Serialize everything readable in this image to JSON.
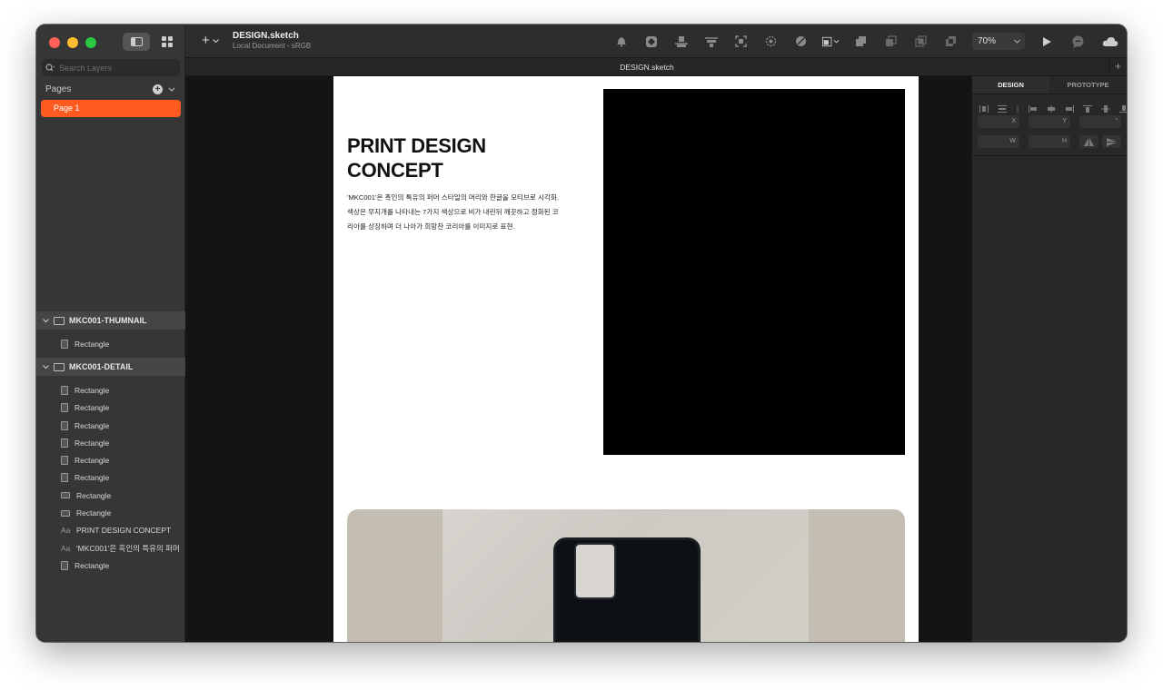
{
  "toolbar": {
    "doc_name": "DESIGN.sketch",
    "doc_sub": "Local Document - sRGB",
    "zoom_value": "70%",
    "tool_icons": [
      "bell-icon",
      "component-icon",
      "distribute-icon",
      "align-icon",
      "frame-icon",
      "mask-icon",
      "scissors-icon",
      "transform-icon",
      "union-icon",
      "subtract-icon",
      "intersect-icon",
      "difference-icon"
    ],
    "right_icons": [
      "play-icon",
      "comment-icon",
      "cloud-icon"
    ]
  },
  "sidebar": {
    "search_placeholder": "Search Layers",
    "pages_label": "Pages",
    "pages": [
      {
        "label": "Page 1",
        "selected": true
      }
    ],
    "groups": [
      {
        "name": "MKC001-THUMNAIL",
        "layers": [
          {
            "label": "Rectangle",
            "icon": "rect"
          }
        ]
      },
      {
        "name": "MKC001-DETAIL",
        "layers": [
          {
            "label": "Rectangle",
            "icon": "rect"
          },
          {
            "label": "Rectangle",
            "icon": "rect"
          },
          {
            "label": "Rectangle",
            "icon": "rect"
          },
          {
            "label": "Rectangle",
            "icon": "rect"
          },
          {
            "label": "Rectangle",
            "icon": "rect"
          },
          {
            "label": "Rectangle",
            "icon": "rect"
          },
          {
            "label": "Rectangle",
            "icon": "rect-wide"
          },
          {
            "label": "Rectangle",
            "icon": "rect-wide"
          },
          {
            "label": "PRINT DESIGN CONCEPT",
            "icon": "text"
          },
          {
            "label": "'MKC001'은 흑인의 특유의 퍼머",
            "icon": "text"
          },
          {
            "label": "Rectangle",
            "icon": "rect"
          }
        ]
      }
    ],
    "text_icon_glyph": "Aa"
  },
  "tabbar": {
    "title": "DESIGN.sketch"
  },
  "canvas": {
    "heading_line1": "PRINT DESIGN",
    "heading_line2": "CONCEPT",
    "body_line1": "'MKC001'은 흑인의 특유의 퍼머 스타일의 머리와 한글을 모티브로 시각화.",
    "body_line2": "색상은 무지개를 나타내는 7가지 색상으로 비가 내린뒤 깨끗하고 정화된 코",
    "body_line3": "리아를 상징하며 더 나아가 희망찬 코리아를 이미지로 표현."
  },
  "inspector": {
    "tab_design": "DESIGN",
    "tab_prototype": "PROTOTYPE",
    "field_x": "X",
    "field_y": "Y",
    "field_rot": "°",
    "field_w": "W",
    "field_h": "H"
  },
  "colors": {
    "accent": "#ff5a1f",
    "canvas": "#141414",
    "sidebar": "#363636"
  }
}
